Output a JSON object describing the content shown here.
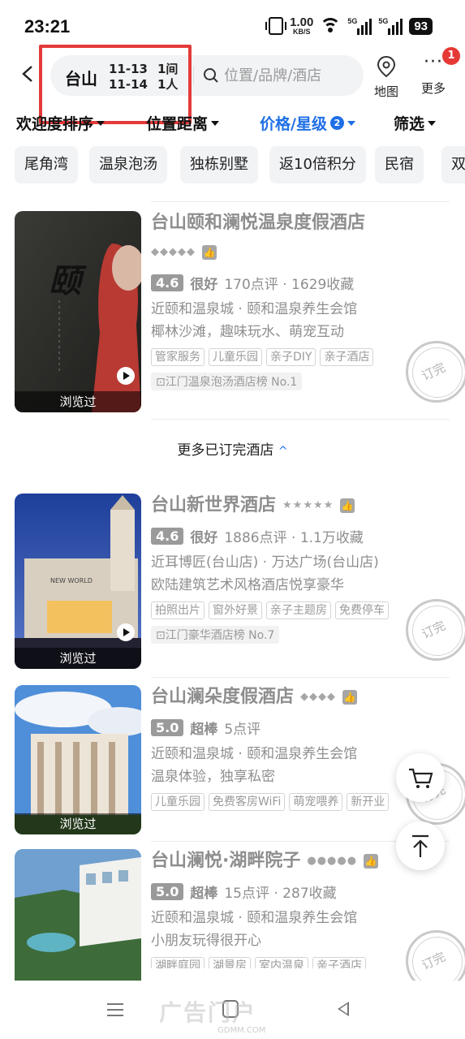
{
  "status_bar": {
    "time": "23:21",
    "speed": "1.00",
    "speed_unit": "KB/S",
    "signal_1": "5G",
    "signal_2": "5G",
    "battery": "93"
  },
  "header": {
    "city": "台山",
    "checkin": "11-13",
    "checkout": "11-14",
    "rooms": "1间",
    "guests": "1人",
    "search_placeholder": "位置/品牌/酒店",
    "map_label": "地图",
    "more_label": "更多",
    "more_badge": "1",
    "highlight_color": "#e43a3a"
  },
  "sort_bar": {
    "items": [
      "欢迎度排序",
      "位置距离",
      "价格/星级",
      "筛选"
    ],
    "active_index": 2,
    "price_star_count": "2",
    "accent": "#1f6fe6"
  },
  "chips": [
    "尾角湾",
    "温泉泡汤",
    "独栋别墅",
    "返10倍积分",
    "民宿",
    "双"
  ],
  "hotels_top": [
    {
      "name": "台山颐和澜悦温泉度假酒店",
      "stars": "◆◆◆◆◆",
      "score": "4.6",
      "score_label": "很好",
      "reviews": "170点评 · 1629收藏",
      "location": "近颐和温泉城 · 颐和温泉养生会馆",
      "desc": "椰林沙滩，趣味玩水、萌宠互动",
      "tags": [
        "管家服务",
        "儿童乐园",
        "亲子DIY",
        "亲子酒店"
      ],
      "rank": "江门温泉泡汤酒店榜 No.1",
      "viewed": "浏览过",
      "stamp": "订完"
    }
  ],
  "more_booked": "更多已订完酒店",
  "hotels_bottom": [
    {
      "name": "台山新世界酒店",
      "stars": "★★★★★",
      "score": "4.6",
      "score_label": "很好",
      "reviews": "1886点评 · 1.1万收藏",
      "location": "近耳博匠(台山店) · 万达广场(台山店)",
      "desc": "欧陆建筑艺术风格酒店悦享豪华",
      "tags": [
        "拍照出片",
        "窗外好景",
        "亲子主题房",
        "免费停车"
      ],
      "rank": "江门豪华酒店榜 No.7",
      "viewed": "浏览过",
      "stamp": "订完"
    },
    {
      "name": "台山澜朵度假酒店",
      "stars": "◆◆◆◆",
      "score": "5.0",
      "score_label": "超棒",
      "reviews": "5点评",
      "location": "近颐和温泉城 · 颐和温泉养生会馆",
      "desc": "温泉体验，独享私密",
      "tags": [
        "儿童乐园",
        "免费客房WiFi",
        "萌宠喂养",
        "新开业"
      ],
      "viewed": "浏览过",
      "stamp": "订完"
    },
    {
      "name": "台山澜悦·湖畔院子",
      "stars": "●●●●●",
      "score": "5.0",
      "score_label": "超棒",
      "reviews": "15点评 · 287收藏",
      "location": "近颐和温泉城 · 颐和温泉养生会馆",
      "desc": "小朋友玩得很开心",
      "tags": [
        "湖畔庭园",
        "湖景房",
        "室内温泉",
        "亲子酒店"
      ],
      "stamp": "订完"
    }
  ],
  "watermark": "GDMM.COM",
  "watermark_brand": "广告门户"
}
